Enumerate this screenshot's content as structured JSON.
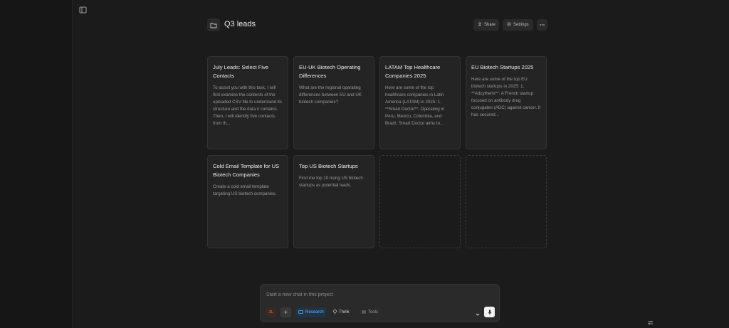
{
  "project": {
    "title": "Q3 leads"
  },
  "header": {
    "share_label": "Share",
    "settings_label": "Settings"
  },
  "cards": [
    {
      "title": "July Leads: Select Five Contacts",
      "body": "To assist you with this task, I will first examine the contents of the uploaded CSV file to understand its structure and the data it contains. Then, I will identify five contacts from th..."
    },
    {
      "title": "EU-UK Biotech Operating Differences",
      "body": "What are the regional operating differences between EU and UK biotech companies?"
    },
    {
      "title": "LATAM Top Healthcare Companies 2025",
      "body": "Here are some of the top healthcare companies in Latin America (LATAM) in 2025: 1. **Smart Doctor**: Operating in Peru, Mexico, Colombia, and Brazil, Smart Doctor aims to..."
    },
    {
      "title": "EU Biotech Startups 2025",
      "body": "Here are some of the top EU biotech startups in 2025: 1. **Adcytherix**: A French startup focused on antibody drug conjugates (ADC) against cancer. It has secured..."
    },
    {
      "title": "Cold Email Template for US Biotech Companies",
      "body": "Create a cold email template targeting US biotech companies."
    },
    {
      "title": "Top US Biotech Startups",
      "body": "Find me top 10 rising US biotech startups as potential leads."
    }
  ],
  "composer": {
    "placeholder": "Start a new chat in this project",
    "avatar_initials": "JL",
    "research_label": "Research",
    "think_label": "Think",
    "tools_label": "Tools"
  },
  "colors": {
    "background": "#1b1b1b",
    "card": "#242424",
    "research_accent": "#6fb4ee",
    "avatar_accent": "#e05a2b"
  },
  "icons": [
    "sidebar-toggle-icon",
    "folder-icon",
    "share-icon",
    "gear-icon",
    "more-icon",
    "plus-icon",
    "research-icon",
    "lightbulb-icon",
    "tools-icon",
    "chevron-down-icon",
    "microphone-icon",
    "settings-sliders-icon"
  ]
}
